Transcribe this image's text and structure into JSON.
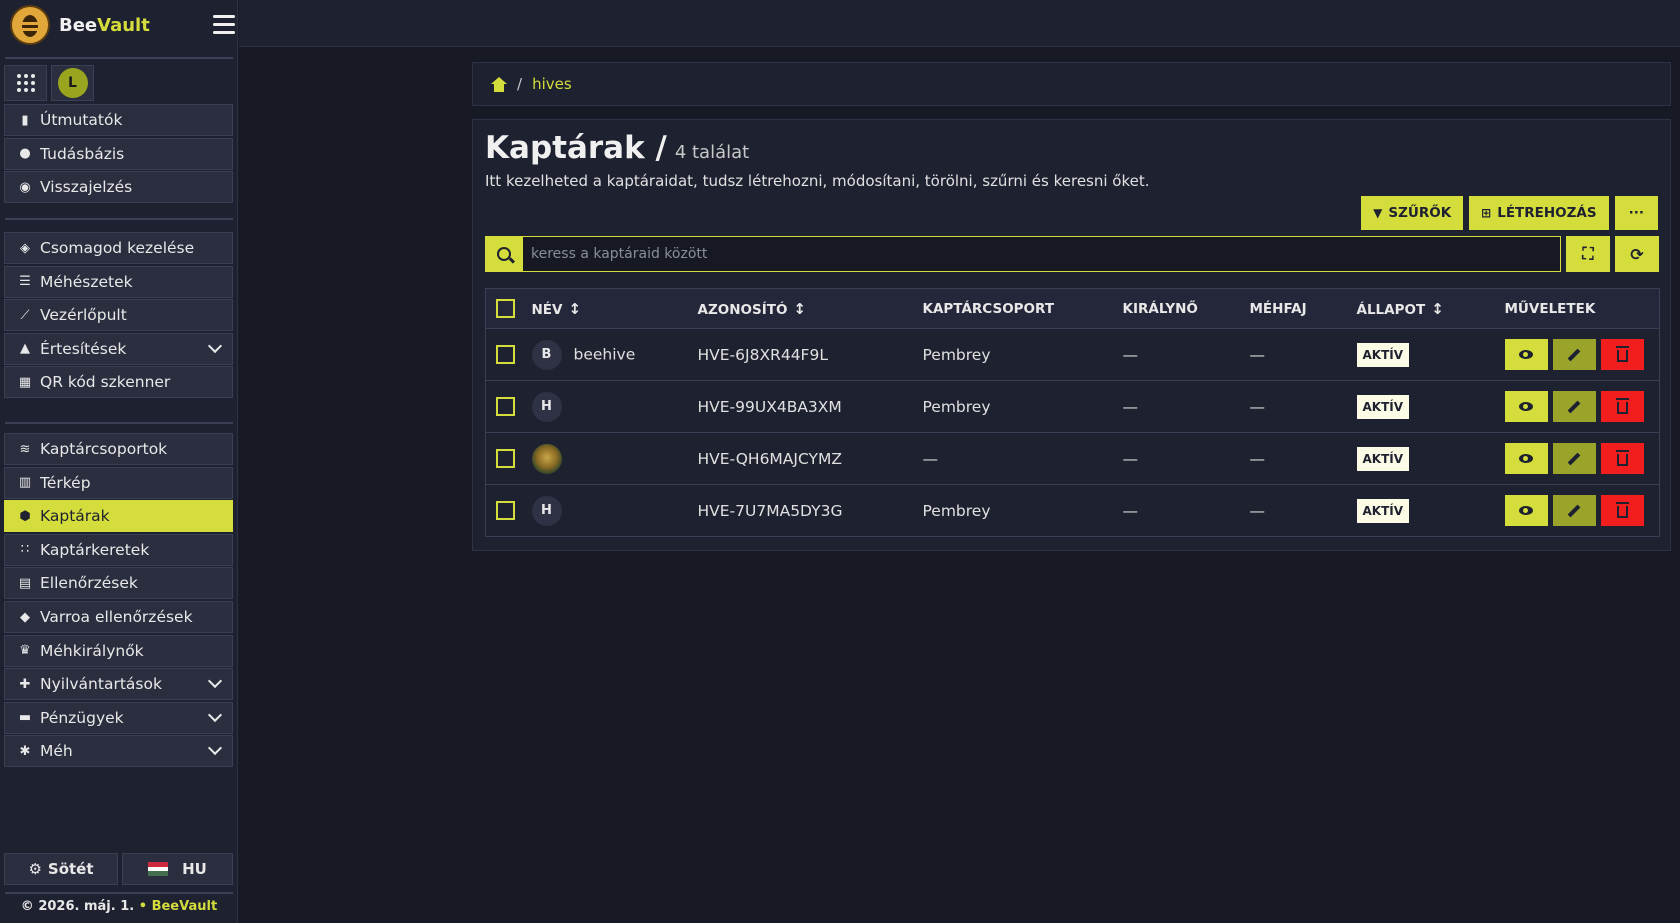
{
  "brand": {
    "name_part1": "Bee",
    "name_part2": "Vault"
  },
  "quick": {
    "avatar_letter": "L"
  },
  "sidebar": {
    "group1": [
      {
        "label": "Útmutatók",
        "icon": "book-icon"
      },
      {
        "label": "Tudásbázis",
        "icon": "user-knowledge-icon"
      },
      {
        "label": "Visszajelzés",
        "icon": "comment-icon"
      }
    ],
    "group2": [
      {
        "label": "Csomagod kezelése",
        "icon": "box-icon"
      },
      {
        "label": "Méhészetek",
        "icon": "apiary-icon"
      },
      {
        "label": "Vezérlőpult",
        "icon": "chart-line-icon"
      },
      {
        "label": "Értesítések",
        "icon": "bell-icon"
      },
      {
        "label": "QR kód szkenner",
        "icon": "qrcode-icon"
      }
    ],
    "group3": [
      {
        "label": "Kaptárcsoportok",
        "icon": "layers-icon"
      },
      {
        "label": "Térkép",
        "icon": "map-icon"
      },
      {
        "label": "Kaptárak",
        "icon": "hexagon-icon"
      },
      {
        "label": "Kaptárkeretek",
        "icon": "grip-icon"
      },
      {
        "label": "Ellenőrzések",
        "icon": "clipboard-icon"
      },
      {
        "label": "Varroa ellenőrzések",
        "icon": "shield-virus-icon"
      },
      {
        "label": "Méhkirálynők",
        "icon": "chess-queen-icon"
      },
      {
        "label": "Nyilvántartások",
        "icon": "file-medical-icon"
      },
      {
        "label": "Pénzügyek",
        "icon": "wallet-icon"
      },
      {
        "label": "Méh",
        "icon": "bug-icon"
      }
    ],
    "theme_label": "Sötét",
    "lang_label": "HU",
    "copyright_text": "© 2026. máj. 1.",
    "copyright_dot": "•",
    "copyright_brand1": "Bee",
    "copyright_brand2": "Vault"
  },
  "breadcrumb": {
    "separator": "/",
    "current": "hives"
  },
  "page": {
    "title": "Kaptárak /",
    "count": "4 találat",
    "subtitle": "Itt kezelheted a kaptáraidat, tudsz létrehozni, módosítani, törölni, szűrni és keresni őket.",
    "filters_label": "SZŰRŐK",
    "create_label": "LÉTREHOZÁS",
    "more_label": "···"
  },
  "search": {
    "placeholder": "keress a kaptáraid között"
  },
  "table": {
    "headers": {
      "name": "NÉV",
      "id": "AZONOSÍTÓ",
      "group": "KAPTÁRCSOPORT",
      "queen": "KIRÁLYNŐ",
      "species": "MÉHFAJ",
      "status": "ÁLLAPOT",
      "actions": "MŰVELETEK"
    },
    "rows": [
      {
        "avatar": "B",
        "name": "beehive",
        "id": "HVE-6J8XR44F9L",
        "group": "Pembrey",
        "queen": "—",
        "species": "—",
        "status": "AKTÍV"
      },
      {
        "avatar": "H",
        "name": "",
        "id": "HVE-99UX4BA3XM",
        "group": "Pembrey",
        "queen": "—",
        "species": "—",
        "status": "AKTÍV"
      },
      {
        "avatar": "",
        "name": "",
        "id": "HVE-QH6MAJCYMZ",
        "group": "—",
        "queen": "—",
        "species": "—",
        "status": "AKTÍV"
      },
      {
        "avatar": "H",
        "name": "",
        "id": "HVE-7U7MA5DY3G",
        "group": "Pembrey",
        "queen": "—",
        "species": "—",
        "status": "AKTÍV"
      }
    ]
  },
  "colors": {
    "accent": "#d4dd3c",
    "danger": "#f21e1e",
    "background": "#171a24",
    "panel": "#1e2130"
  }
}
